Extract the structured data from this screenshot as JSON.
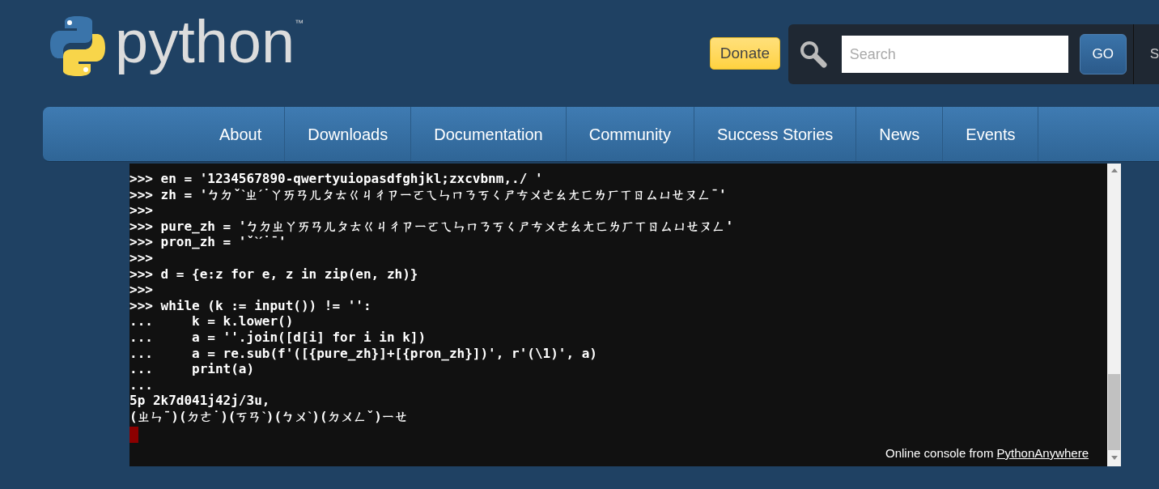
{
  "logo": {
    "wordmark": "python",
    "trademark": "™"
  },
  "donate": {
    "label": "Donate"
  },
  "search": {
    "placeholder": "Search",
    "button": "GO",
    "next_item": "S"
  },
  "nav": [
    {
      "label": "About"
    },
    {
      "label": "Downloads"
    },
    {
      "label": "Documentation"
    },
    {
      "label": "Community"
    },
    {
      "label": "Success Stories"
    },
    {
      "label": "News"
    },
    {
      "label": "Events"
    }
  ],
  "console": {
    "lines": [
      ">>> en = '1234567890-qwertyuiopasdfghjkl;zxcvbnm,./ '",
      ">>> zh = 'ㄅㄉˇˋㄓˊ˙ㄚㄞㄢㄦㄆㄊㄍㄐㄔㄗㄧㄛㄟㄣㄇㄋㄎㄑㄕㄘㄨㄜㄠㄤㄈㄌㄏㄒㄖㄙㄩㄝㄡㄥˉ'",
      ">>>",
      ">>> pure_zh = 'ㄅㄉㄓㄚㄞㄢㄦㄆㄊㄍㄐㄔㄗㄧㄛㄟㄣㄇㄋㄎㄑㄕㄘㄨㄜㄠㄤㄈㄌㄏㄒㄖㄙㄩㄝㄡㄥ'",
      ">>> pron_zh = 'ˇˋˊ˙ˉ'",
      ">>>",
      ">>> d = {e:z for e, z in zip(en, zh)}",
      ">>>",
      ">>> while (k := input()) != '':",
      "...     k = k.lower()",
      "...     a = ''.join([d[i] for i in k])",
      "...     a = re.sub(f'([{pure_zh}]+[{pron_zh}])', r'(\\1)', a)",
      "...     print(a)",
      "...",
      "5p 2k7d041j42j/3u,",
      "(ㄓㄣˉ)(ㄉㄜ˙)(ㄎㄢˋ)(ㄅㄨˋ)(ㄉㄨㄥˇ)ㄧㄝ"
    ],
    "footer_text": "Online console from ",
    "footer_link": "PythonAnywhere"
  }
}
